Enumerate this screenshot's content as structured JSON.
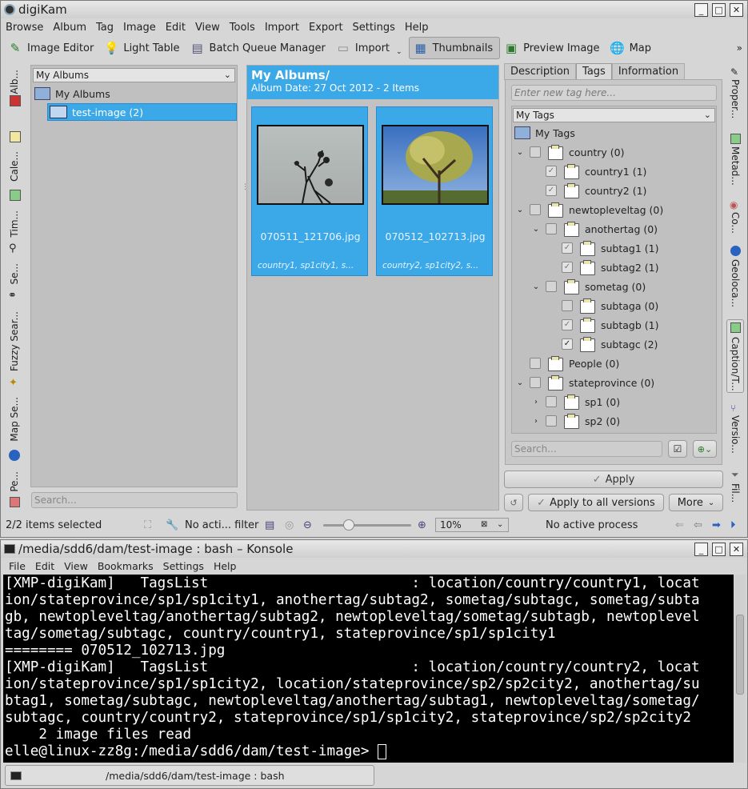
{
  "app": {
    "title": "digiKam",
    "menu": [
      "Browse",
      "Album",
      "Tag",
      "Image",
      "Edit",
      "View",
      "Tools",
      "Import",
      "Export",
      "Settings",
      "Help"
    ],
    "toolbar": {
      "image_editor": "Image Editor",
      "light_table": "Light Table",
      "batch_queue": "Batch Queue Manager",
      "import": "Import",
      "thumbnails": "Thumbnails",
      "preview": "Preview Image",
      "map": "Map"
    },
    "left_tabs": [
      "Alb...",
      "Cale...",
      "Tim...",
      "Se...",
      "Fuzzy Sear...",
      "Map Se...",
      "Pe..."
    ],
    "right_tabs": [
      "Proper...",
      "Metad...",
      "Co...",
      "Geoloca...",
      "Caption/T...",
      "Versio...",
      "Fil..."
    ],
    "albums": {
      "combo": "My Albums",
      "root": "My Albums",
      "child": "test-image (2)",
      "search_placeholder": "Search..."
    },
    "view": {
      "header_title": "My Albums/",
      "header_sub": "Album Date: 27 Oct 2012 - 2 Items",
      "items": [
        {
          "name": "070511_121706.jpg",
          "tags": "country1, sp1city1, s..."
        },
        {
          "name": "070512_102713.jpg",
          "tags": "country2, sp1city2, s..."
        }
      ]
    },
    "right_panel": {
      "tabs": [
        "Description",
        "Tags",
        "Information"
      ],
      "new_tag_placeholder": "Enter new tag here...",
      "combo": "My Tags",
      "root": "My Tags",
      "tags": [
        {
          "label": "country (0)",
          "depth": 0,
          "exp": "v",
          "check": ""
        },
        {
          "label": "country1 (1)",
          "depth": 1,
          "exp": "",
          "check": "partial"
        },
        {
          "label": "country2 (1)",
          "depth": 1,
          "exp": "",
          "check": "partial"
        },
        {
          "label": "newtopleveltag (0)",
          "depth": 0,
          "exp": "v",
          "check": ""
        },
        {
          "label": "anothertag (0)",
          "depth": 1,
          "exp": "v",
          "check": ""
        },
        {
          "label": "subtag1 (1)",
          "depth": 2,
          "exp": "",
          "check": "partial"
        },
        {
          "label": "subtag2 (1)",
          "depth": 2,
          "exp": "",
          "check": "partial"
        },
        {
          "label": "sometag (0)",
          "depth": 1,
          "exp": "v",
          "check": ""
        },
        {
          "label": "subtaga (0)",
          "depth": 2,
          "exp": "",
          "check": ""
        },
        {
          "label": "subtagb (1)",
          "depth": 2,
          "exp": "",
          "check": "partial"
        },
        {
          "label": "subtagc (2)",
          "depth": 2,
          "exp": "",
          "check": "checked"
        },
        {
          "label": "People (0)",
          "depth": 0,
          "exp": "",
          "check": ""
        },
        {
          "label": "stateprovince (0)",
          "depth": 0,
          "exp": "v",
          "check": ""
        },
        {
          "label": "sp1 (0)",
          "depth": 1,
          "exp": ">",
          "check": ""
        },
        {
          "label": "sp2 (0)",
          "depth": 1,
          "exp": ">",
          "check": ""
        }
      ],
      "search_placeholder": "Search...",
      "apply": "Apply",
      "apply_all": "Apply to all versions",
      "more": "More"
    },
    "status": {
      "selected": "2/2 items selected",
      "filter": "No acti... filter",
      "zoom": "10%",
      "process": "No active process"
    }
  },
  "konsole": {
    "title": "/media/sdd6/dam/test-image : bash – Konsole",
    "menu": [
      "File",
      "Edit",
      "View",
      "Bookmarks",
      "Settings",
      "Help"
    ],
    "lines": [
      "[XMP-digiKam]   TagsList                        : location/country/country1, locat",
      "ion/stateprovince/sp1/sp1city1, anothertag/subtag2, sometag/subtagc, sometag/subta",
      "gb, newtopleveltag/anothertag/subtag2, newtopleveltag/sometag/subtagb, newtoplevel",
      "tag/sometag/subtagc, country/country1, stateprovince/sp1/sp1city1",
      "======== 070512_102713.jpg",
      "[XMP-digiKam]   TagsList                        : location/country/country2, locat",
      "ion/stateprovince/sp1/sp1city2, location/stateprovince/sp2/sp2city2, anothertag/su",
      "btag1, sometag/subtagc, newtopleveltag/anothertag/subtag1, newtopleveltag/sometag/",
      "subtagc, country/country2, stateprovince/sp1/sp1city2, stateprovince/sp2/sp2city2",
      "    2 image files read",
      "elle@linux-zz8g:/media/sdd6/dam/test-image> "
    ],
    "tab_label": "/media/sdd6/dam/test-image : bash"
  }
}
